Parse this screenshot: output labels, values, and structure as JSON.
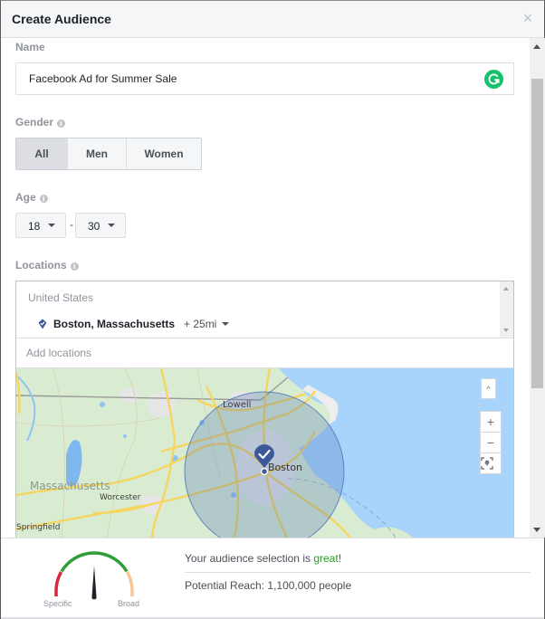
{
  "dialog": {
    "title": "Create Audience",
    "close_icon": "close-icon"
  },
  "name_section": {
    "label": "Name",
    "value": "Facebook Ad for Summer Sale",
    "extension_icon": "grammarly-icon"
  },
  "gender": {
    "label": "Gender",
    "options": [
      {
        "label": "All",
        "selected": true
      },
      {
        "label": "Men",
        "selected": false
      },
      {
        "label": "Women",
        "selected": false
      }
    ]
  },
  "age": {
    "label": "Age",
    "min": "18",
    "separator": "-",
    "max": "30"
  },
  "locations": {
    "label": "Locations",
    "country": "United States",
    "items": [
      {
        "name": "Boston, Massachusetts",
        "radius": "+ 25mi",
        "icon": "location-pin-icon"
      }
    ],
    "add_placeholder": "Add locations"
  },
  "map": {
    "labels": {
      "lowell": "Lowell",
      "boston": "Boston",
      "massachusetts": "Massachusetts",
      "worcester": "Worcester",
      "springfield": "Springfield"
    },
    "controls": {
      "collapse": "^",
      "zoom_in": "+",
      "zoom_out": "−"
    },
    "colors": {
      "land": "#d9ecd2",
      "water": "#a8d4fb",
      "roads": "#f6d660",
      "radius_fill": "#4a6fb5",
      "pin": "#3b5998"
    }
  },
  "footer": {
    "gauge": {
      "specific_label": "Specific",
      "broad_label": "Broad",
      "level": 0.5,
      "colors": {
        "specific": "#d7263d",
        "good": "#2f9e39",
        "broad": "#f4c794",
        "needle": "#1d2129"
      }
    },
    "status_prefix": "Your audience selection is ",
    "status_word": "great",
    "status_suffix": "!",
    "reach": "Potential Reach: 1,100,000 people"
  }
}
